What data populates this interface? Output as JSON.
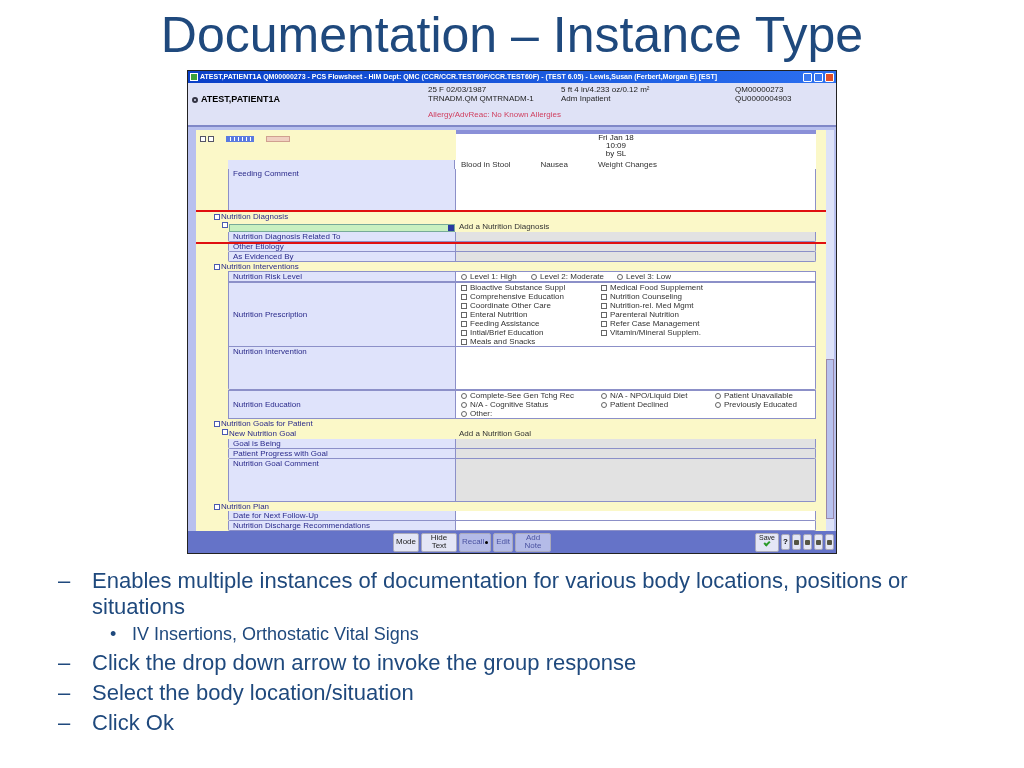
{
  "slide": {
    "title": "Documentation – Instance Type",
    "bullets": [
      {
        "marker": "–",
        "text": "Enables multiple instances of documentation for various body locations, positions or situations",
        "children": [
          {
            "marker": "•",
            "text": "IV Insertions, Orthostatic Vital Signs"
          }
        ]
      },
      {
        "marker": "–",
        "text": "Click the drop down arrow to invoke the group response"
      },
      {
        "marker": "–",
        "text": "Select the body location/situation"
      },
      {
        "marker": "–",
        "text": "Click Ok"
      }
    ]
  },
  "window": {
    "title": "ATEST,PATIENT1A QM00000273 - PCS Flowsheet - HIM Dept: QMC (CCR/CCR.TEST60F/CCR.TEST60F) - (TEST 6.05) - Lewis,Susan (Ferbert,Morgan E) [EST]"
  },
  "patient": {
    "name": "ATEST,PATIENT1A",
    "details": [
      [
        "25 F 02/03/1987",
        "TRNADM.QM QMTRNADM-1"
      ],
      [
        "5 ft 4 in/4.233 oz/0.12 m²",
        "Adm Inpatient"
      ],
      [
        "QM00000273",
        "QU0000004903"
      ]
    ],
    "allergy": "Allergy/AdvReac: No Known Allergies"
  },
  "column_header": [
    "Fri Jan 18",
    "10:09",
    "by SL"
  ],
  "rows": [
    {
      "kind": "cut_options",
      "options": [
        "Blood in Stool",
        "Nausea",
        "Weight Changes"
      ]
    },
    {
      "kind": "memo",
      "label": "Feeding Comment",
      "disabled": false
    },
    {
      "kind": "section",
      "label": "Nutrition Diagnosis",
      "highlighted": true
    },
    {
      "kind": "instance",
      "action": "Add a Nutrition Diagnosis",
      "highlighted": true
    },
    {
      "kind": "field",
      "label": "Nutrition Diagnosis Related To",
      "disabled": true,
      "highlighted": true
    },
    {
      "kind": "field",
      "label": "Other Etiology",
      "disabled": true
    },
    {
      "kind": "field",
      "label": "As Evidenced By",
      "disabled": true
    },
    {
      "kind": "section",
      "label": "Nutrition Interventions"
    },
    {
      "kind": "radios",
      "label": "Nutrition Risk Level",
      "options": [
        {
          "text": "Level 1: High",
          "checked": false
        },
        {
          "text": "Level 2: Moderate",
          "checked": false
        },
        {
          "text": "Level 3: Low",
          "checked": false
        }
      ]
    },
    {
      "kind": "checks",
      "label": "Nutrition Prescription",
      "options": [
        {
          "text": "Bioactive Substance Suppl",
          "checked": false
        },
        {
          "text": "Medical Food Supplement",
          "checked": false
        },
        {
          "text": "Comprehensive Education",
          "checked": false
        },
        {
          "text": "Nutrition Counseling",
          "checked": false
        },
        {
          "text": "Coordinate Other Care",
          "checked": false
        },
        {
          "text": "Nutrition-rel. Med Mgmt",
          "checked": false
        },
        {
          "text": "Enteral Nutrition",
          "checked": false
        },
        {
          "text": "Parenteral Nutrition",
          "checked": false
        },
        {
          "text": "Feeding Assistance",
          "checked": false
        },
        {
          "text": "Refer Case Management",
          "checked": false
        },
        {
          "text": "Intial/Brief Education",
          "checked": false
        },
        {
          "text": "Vitamin/Mineral Supplem.",
          "checked": false
        },
        {
          "text": "Meals and Snacks",
          "checked": false
        }
      ]
    },
    {
      "kind": "memo",
      "label": "Nutrition Intervention",
      "disabled": false
    },
    {
      "kind": "radios",
      "label": "Nutrition Education",
      "options": [
        {
          "text": "Complete-See Gen Tchg Rec",
          "checked": false
        },
        {
          "text": "N/A - NPO/Liquid Diet",
          "checked": false
        },
        {
          "text": "Patient Unavailable",
          "checked": false
        },
        {
          "text": "N/A - Cognitive Status",
          "checked": false
        },
        {
          "text": "Patient Declined",
          "checked": false
        },
        {
          "text": "Previously Educated",
          "checked": false
        },
        {
          "text": "Other:",
          "checked": false
        }
      ]
    },
    {
      "kind": "section",
      "label": "Nutrition Goals for Patient"
    },
    {
      "kind": "instance",
      "label": "New Nutrition Goal",
      "action": "Add a Nutrition Goal"
    },
    {
      "kind": "field",
      "label": "Goal is Being",
      "disabled": true
    },
    {
      "kind": "field",
      "label": "Patient Progress with Goal",
      "disabled": true
    },
    {
      "kind": "memo",
      "label": "Nutrition Goal Comment",
      "disabled": true
    },
    {
      "kind": "section",
      "label": "Nutrition Plan"
    },
    {
      "kind": "field",
      "label": "Date for Next Follow-Up",
      "disabled": false
    },
    {
      "kind": "field",
      "label": "Nutrition Discharge Recommendations",
      "disabled": false
    }
  ],
  "toolbar": {
    "buttons": [
      {
        "label": "Mode",
        "disabled": false
      },
      {
        "label": "Hide Text",
        "disabled": false
      },
      {
        "label": "Recall",
        "disabled": true,
        "dropdown": true
      },
      {
        "label": "Edit",
        "disabled": true
      },
      {
        "label": "Add Note",
        "disabled": true
      }
    ],
    "save": "Save",
    "help": "?"
  }
}
